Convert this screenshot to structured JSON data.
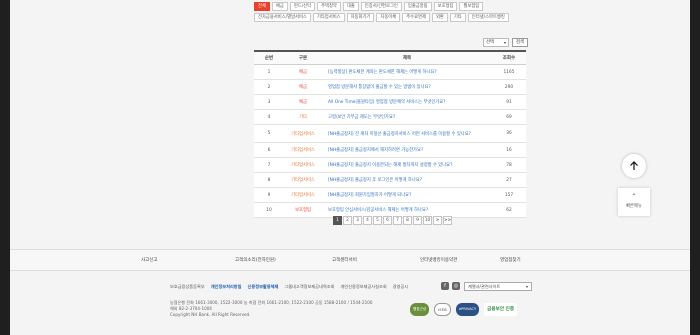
{
  "categories": [
    {
      "label": "전체",
      "active": true
    },
    {
      "label": "예금",
      "active": false
    },
    {
      "label": "펀드/신탁",
      "active": false
    },
    {
      "label": "주택청약",
      "active": false
    },
    {
      "label": "대출",
      "active": false
    },
    {
      "label": "인증서/간편로그인",
      "active": false
    },
    {
      "label": "입출금알림",
      "active": false
    },
    {
      "label": "보호형팁",
      "active": false
    },
    {
      "label": "월보험팁",
      "active": false
    },
    {
      "label": "전자금융서비스/별방서비스",
      "active": false
    },
    {
      "label": "기타업서비스",
      "active": false
    },
    {
      "label": "자동화기기",
      "active": false
    },
    {
      "label": "자동이체",
      "active": false
    },
    {
      "label": "주수료면제",
      "active": false
    },
    {
      "label": "외환",
      "active": false
    },
    {
      "label": "기타",
      "active": false
    },
    {
      "label": "인터넷/스마트뱅킹",
      "active": false
    }
  ],
  "search": {
    "select_value": "선택",
    "button_label": "검색"
  },
  "table": {
    "headers": {
      "no": "순번",
      "category": "구분",
      "title": "제목",
      "views": "조회수"
    },
    "rows": [
      {
        "no": "1",
        "category": "예금",
        "cat_color": "red",
        "title": "[능력향상] 판도채한 계좌는 판도채한 해제는 어떻게 하나요?",
        "views": "1165",
        "tall": false
      },
      {
        "no": "2",
        "category": "예금",
        "cat_color": "red",
        "title": "영업점 방문해서 통장없이 출금할 수 있는 방법이 있나요?",
        "views": "290",
        "tall": false
      },
      {
        "no": "3",
        "category": "예금",
        "cat_color": "red",
        "title": "All One Time(올원타임) 영업점 방문예약 서비스는 무엇인가요?",
        "views": "91",
        "tall": false
      },
      {
        "no": "4",
        "category": "기타",
        "cat_color": "orange",
        "title": "고령/보안 기부금 제도는 무엇인가요?",
        "views": "69",
        "tall": false
      },
      {
        "no": "5",
        "category": "기타업서비스",
        "cat_color": "orange",
        "title": "[NH출금정지] 전 계좌 미정산 출금정지서비스 어떤 서비스를 이용할 수 있나요?",
        "views": "36",
        "tall": true
      },
      {
        "no": "6",
        "category": "기타업서비스",
        "cat_color": "orange",
        "title": "[NH출금정지] 출금정지에서 해지하려면 가능한가요?",
        "views": "16",
        "tall": false
      },
      {
        "no": "7",
        "category": "기타업서비스",
        "cat_color": "orange",
        "title": "[NH출금정지] 출금정지 이용한되는 해제 절차까지 설정할 수 있나요?",
        "views": "78",
        "tall": false
      },
      {
        "no": "8",
        "category": "기타업서비스",
        "cat_color": "orange",
        "title": "[NH출금정지] 출금정지 후 로그인은 어떻게 하나요?",
        "views": "27",
        "tall": false
      },
      {
        "no": "9",
        "category": "기타업서비스",
        "cat_color": "orange",
        "title": "[NH출금정지] 회원가입절차가 어떻게 되나요?",
        "views": "157",
        "tall": false
      },
      {
        "no": "10",
        "category": "보호형팁",
        "cat_color": "red",
        "title": "보호형팁 안심서비스/감공서비스 해제는 어떻게 하나요?",
        "views": "62",
        "tall": false
      }
    ]
  },
  "pagination": {
    "pages": [
      "1",
      "2",
      "3",
      "4",
      "5",
      "6",
      "7",
      "8",
      "9",
      "10"
    ],
    "current": "1",
    "next": ">",
    "last": ">>"
  },
  "quick_menu": {
    "label": "빠른메뉴"
  },
  "footer": {
    "top_links": [
      "사고신고",
      "고객의소리(전자민원)",
      "고객센터서비",
      "인터넷뱅킹이용약관",
      "영업점찾기"
    ],
    "links": [
      {
        "label": "보호금융상품등록부",
        "highlight": false
      },
      {
        "label": "개인정보처리방침",
        "highlight": true
      },
      {
        "label": "신용정보활용체제",
        "highlight": true
      },
      {
        "label": "그룹내고객정보제공내역조회",
        "highlight": false
      },
      {
        "label": "개인신용정보제공사실조회",
        "highlight": false
      },
      {
        "label": "경영공시",
        "highlight": false
      }
    ],
    "info_lines": [
      "농협은행 전화 1661-3000, 1522-3000     농 축협 전화 1661-2100, 1522-2100     공동 1588-2100 / 1544-2100",
      "해외 82-2-3704-1004",
      "Copyright NH Bank. All Right Reserved."
    ],
    "family_site": "계열사/관련사이트",
    "badges": [
      "웹접근성",
      "ISMS",
      "ePRIVACY",
      "금융보안 인증"
    ]
  }
}
